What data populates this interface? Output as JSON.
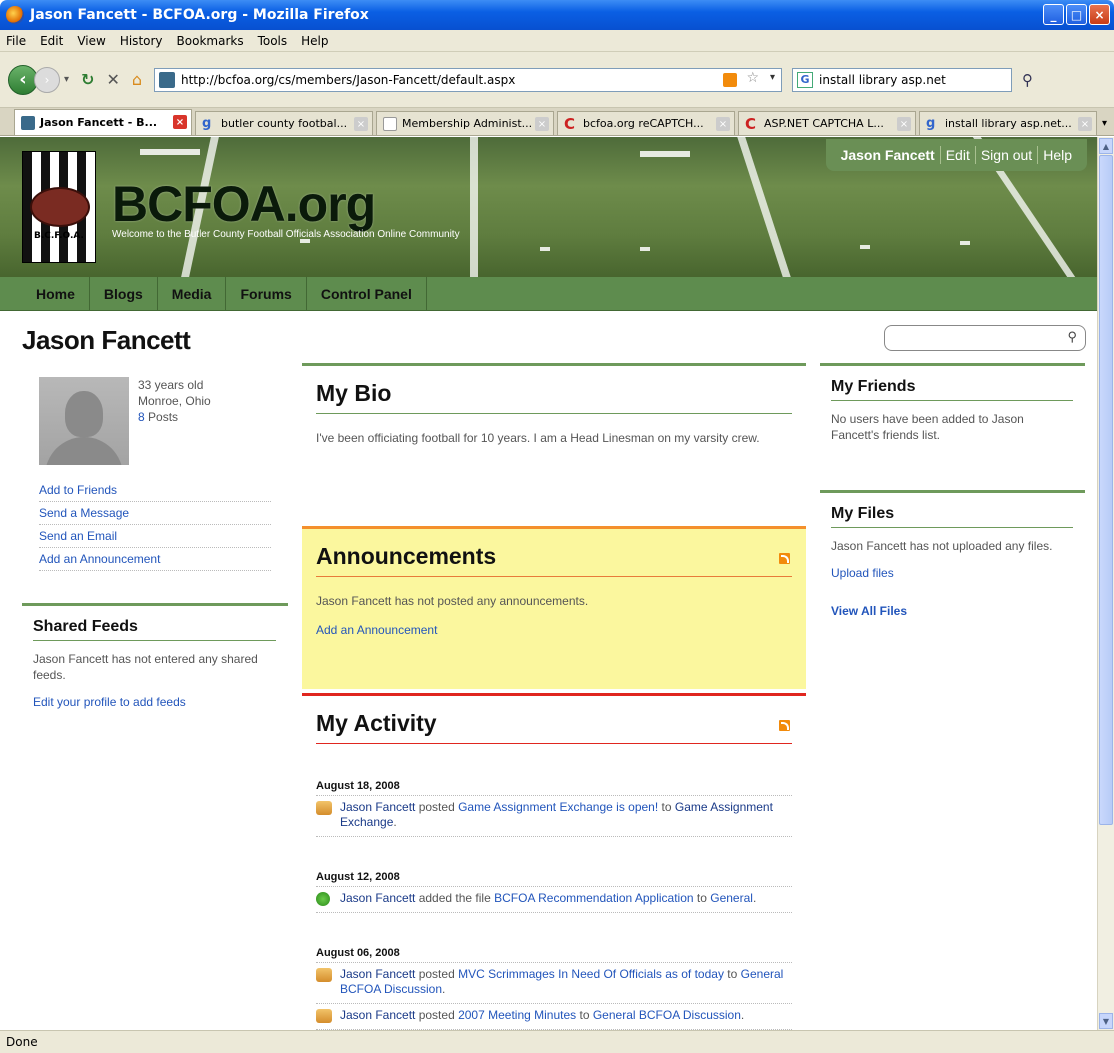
{
  "window": {
    "title": "Jason Fancett - BCFOA.org - Mozilla Firefox",
    "controls": [
      "_",
      "□",
      "×"
    ]
  },
  "menu": [
    "File",
    "Edit",
    "View",
    "History",
    "Bookmarks",
    "Tools",
    "Help"
  ],
  "navbar": {
    "url": "http://bcfoa.org/cs/members/Jason-Fancett/default.aspx",
    "search_value": "install library asp.net"
  },
  "tabs": [
    {
      "label": "Jason Fancett - B...",
      "active": true,
      "favicon_color": "#3a6a8a"
    },
    {
      "label": "butler county footbal...",
      "active": false,
      "favicon_color": "#3366cc"
    },
    {
      "label": "Membership Administ...",
      "active": false,
      "favicon_color": "#cfd8e8"
    },
    {
      "label": "bcfoa.org reCAPTCH...",
      "active": false,
      "favicon_color": "#cc2222"
    },
    {
      "label": "ASP.NET CAPTCHA L...",
      "active": false,
      "favicon_color": "#cc2222"
    },
    {
      "label": "install library asp.net...",
      "active": false,
      "favicon_color": "#3366cc"
    }
  ],
  "site": {
    "logo_label": "B.C.F.O.A.",
    "title": "BCFOA.org",
    "tagline": "Welcome to the Butler County Football Officials Association Online Community",
    "user": {
      "name": "Jason Fancett",
      "edit": "Edit",
      "signout": "Sign out",
      "help": "Help"
    },
    "nav": [
      "Home",
      "Blogs",
      "Media",
      "Forums",
      "Control Panel"
    ]
  },
  "page": {
    "title": "Jason Fancett",
    "profile": {
      "age": "33 years old",
      "location": "Monroe, Ohio",
      "posts_count": "8",
      "posts_label": " Posts",
      "links": [
        "Add to Friends",
        "Send a Message",
        "Send an Email",
        "Add an Announcement"
      ]
    },
    "shared_feeds": {
      "title": "Shared Feeds",
      "text": "Jason Fancett has not entered any shared feeds.",
      "link": "Edit your profile to add feeds"
    },
    "bio": {
      "title": "My Bio",
      "text": "I've been officiating football for 10 years.  I am a Head Linesman on my varsity crew."
    },
    "announcements": {
      "title": "Announcements",
      "text": "Jason Fancett has not posted any announcements.",
      "link": "Add an Announcement"
    },
    "activity": {
      "title": "My Activity",
      "groups": [
        {
          "date": "August 18, 2008",
          "items": [
            {
              "icon": "post",
              "user": "Jason Fancett",
              "verb": " posted ",
              "object": "Game Assignment Exchange is open!",
              "prep": " to ",
              "target": "Game Assignment Exchange",
              "end": "."
            }
          ]
        },
        {
          "date": "August 12, 2008",
          "items": [
            {
              "icon": "file",
              "user": "Jason Fancett",
              "verb": " added the file ",
              "object": "BCFOA Recommendation Application",
              "prep": " to ",
              "target": "General",
              "end": "."
            }
          ]
        },
        {
          "date": "August 06, 2008",
          "items": [
            {
              "icon": "post",
              "user": "Jason Fancett",
              "verb": " posted ",
              "object": "MVC Scrimmages In Need Of Officials as of today",
              "prep": " to ",
              "target": "General BCFOA Discussion",
              "end": "."
            },
            {
              "icon": "post",
              "user": "Jason Fancett",
              "verb": " posted ",
              "object": "2007 Meeting Minutes",
              "prep": " to ",
              "target": "General BCFOA Discussion",
              "end": "."
            }
          ]
        }
      ]
    },
    "friends": {
      "title": "My Friends",
      "text": "No users have been added to Jason Fancett's friends list."
    },
    "files": {
      "title": "My Files",
      "text": "Jason Fancett has not uploaded any files.",
      "upload": "Upload files",
      "view_all": "View All Files"
    }
  },
  "status": "Done"
}
